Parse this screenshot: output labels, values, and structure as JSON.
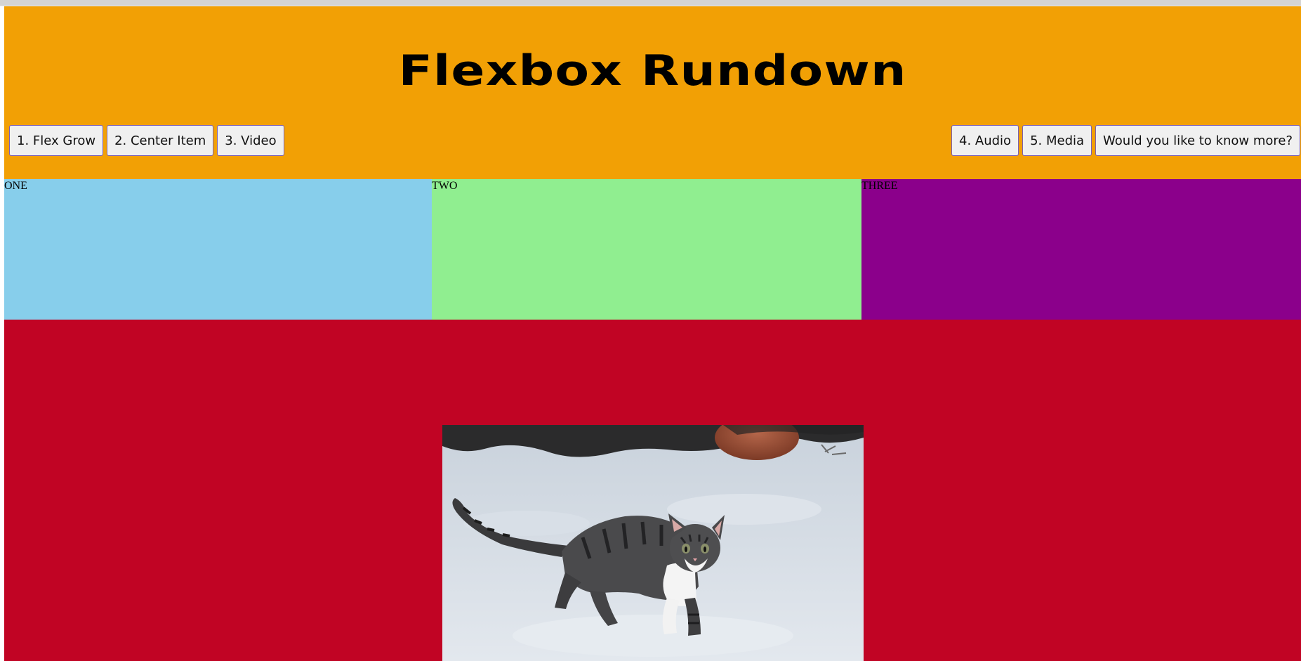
{
  "header": {
    "title": "Flexbox Rundown"
  },
  "nav": {
    "left": [
      {
        "label": "1. Flex Grow"
      },
      {
        "label": "2. Center Item"
      },
      {
        "label": "3. Video"
      }
    ],
    "right": [
      {
        "label": "4. Audio"
      },
      {
        "label": "5. Media"
      },
      {
        "label": "Would you like to know more?"
      }
    ]
  },
  "boxes": [
    {
      "label": "ONE",
      "color": "#87ceeb"
    },
    {
      "label": "TWO",
      "color": "#90ee90"
    },
    {
      "label": "THREE",
      "color": "#8b008b"
    }
  ],
  "colors": {
    "header": "#f2a005",
    "media_section": "#c10424"
  },
  "media": {
    "image_icon": "kitten-in-snow-photo"
  }
}
